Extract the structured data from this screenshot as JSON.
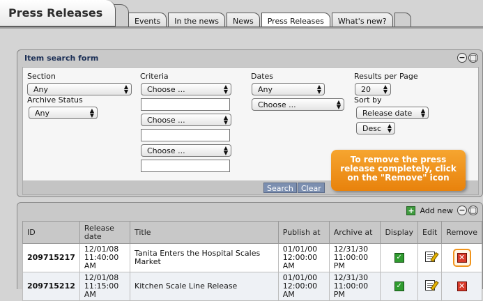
{
  "app": {
    "title": "Press Releases"
  },
  "tabs": [
    {
      "label": "Events"
    },
    {
      "label": "In the news"
    },
    {
      "label": "News"
    },
    {
      "label": "Press Releases",
      "active": true
    },
    {
      "label": "What's new?"
    }
  ],
  "search": {
    "title": "Item search form",
    "section": {
      "label": "Section",
      "value": "Any"
    },
    "archive_status": {
      "label": "Archive Status",
      "value": "Any"
    },
    "criteria": {
      "label": "Criteria",
      "selects": [
        "Choose ...",
        "Choose ...",
        "Choose ..."
      ]
    },
    "dates": {
      "label": "Dates",
      "value": "Any",
      "choose": "Choose ..."
    },
    "results_per_page": {
      "label": "Results per Page",
      "value": "20"
    },
    "sort_by": {
      "label": "Sort by",
      "value": "Release date",
      "order": "Desc"
    },
    "search_button": "Search",
    "clear_button": "Clear"
  },
  "callout": {
    "text": "To remove the press release completely, click on the \"Remove\" icon"
  },
  "results": {
    "add_new": "Add new",
    "columns": [
      "ID",
      "Release date",
      "Title",
      "Publish at",
      "Archive at",
      "Display",
      "Edit",
      "Remove"
    ],
    "rows": [
      {
        "id": "209715217",
        "release": "12/01/08 11:40:00 AM",
        "title": "Tanita Enters the Hospital Scales Market",
        "publish": "01/01/00 12:00:00 AM",
        "archive": "12/31/30 11:00:00 PM"
      },
      {
        "id": "209715212",
        "release": "12/01/08 11:15:00 AM",
        "title": "Kitchen Scale Line Release",
        "publish": "01/01/00 12:00:00 AM",
        "archive": "12/31/30 11:00:00 PM"
      }
    ]
  },
  "colors": {
    "callout": "#f0941c",
    "link": "#1a2e55"
  }
}
